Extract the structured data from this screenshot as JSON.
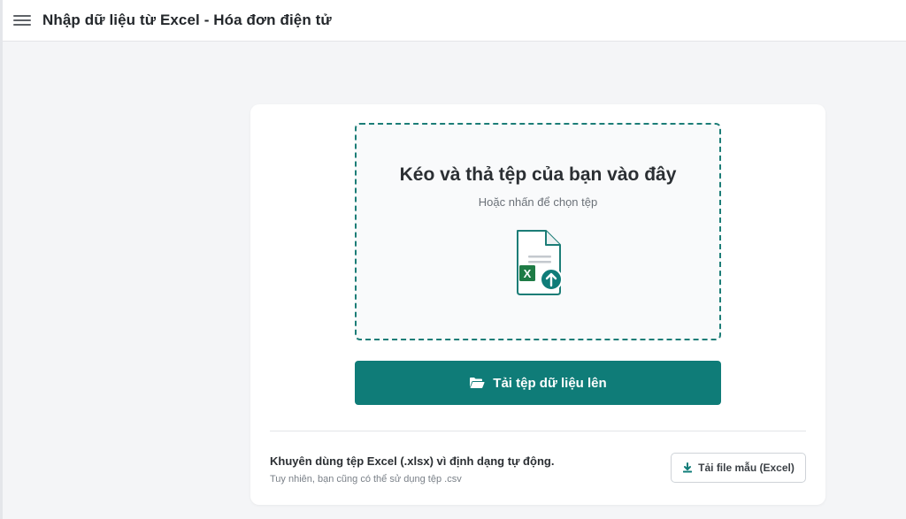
{
  "header": {
    "title": "Nhập dữ liệu từ Excel - Hóa đơn điện tử",
    "menu_icon": "hamburger-menu-icon"
  },
  "dropzone": {
    "title": "Kéo và thả tệp của bạn vào đây",
    "subtitle": "Hoặc nhấn để chọn tệp",
    "icon": "excel-file-upload-icon",
    "icon_badge": "X"
  },
  "upload_button": {
    "label": "Tải tệp dữ liệu lên",
    "icon": "folder-open-icon"
  },
  "footer": {
    "recommendation": "Khuyên dùng tệp Excel (.xlsx) vì định dạng tự động.",
    "note": "Tuy nhiên, bạn cũng có thể sử dụng tệp .csv",
    "sample_button": {
      "label": "Tải file mẫu (Excel)",
      "icon": "download-icon"
    }
  },
  "colors": {
    "accent": "#0f7c78",
    "dropzone_border": "#1c7d77",
    "excel_green": "#1e7b45",
    "background": "#f4f5f7"
  }
}
